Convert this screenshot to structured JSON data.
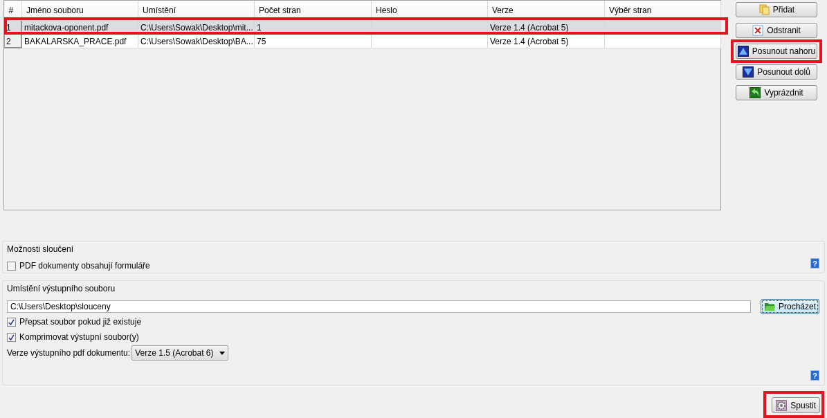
{
  "table": {
    "columns": [
      "#",
      "Jméno souboru",
      "Umístění",
      "Počet stran",
      "Heslo",
      "Verze",
      "Výběr stran"
    ],
    "rows": [
      {
        "selected": true,
        "highlighted": true,
        "cells": [
          "1",
          "mitackova-oponent.pdf",
          "C:\\Users\\Sowak\\Desktop\\mit...",
          "1",
          "",
          "Verze 1.4 (Acrobat 5)",
          ""
        ]
      },
      {
        "selected": false,
        "highlighted": false,
        "cells": [
          "2",
          "BAKALARSKA_PRACE.pdf",
          "C:\\Users\\Sowak\\Desktop\\BA...",
          "75",
          "",
          "Verze 1.4 (Acrobat 5)",
          ""
        ]
      }
    ]
  },
  "side_buttons": [
    {
      "kind": "add",
      "label": "Přidat",
      "highlighted": false
    },
    {
      "kind": "remove",
      "label": "Odstranit",
      "highlighted": false
    },
    {
      "kind": "up",
      "label": "Posunout nahoru",
      "highlighted": true
    },
    {
      "kind": "down",
      "label": "Posunout dolů",
      "highlighted": false
    },
    {
      "kind": "clear",
      "label": "Vyprázdnit",
      "highlighted": false
    }
  ],
  "merge_options": {
    "title": "Možnosti sloučení",
    "checkboxes": [
      {
        "label": "PDF dokumenty obsahují formuláře",
        "checked": false
      }
    ],
    "help": "?"
  },
  "output": {
    "title": "Umístění výstupního souboru",
    "path": "C:\\Users\\Desktop\\slouceny",
    "browse": "Procházet",
    "checkboxes": [
      {
        "label": "Přepsat soubor pokud již existuje",
        "checked": true
      },
      {
        "label": "Komprimovat výstupní soubor(y)",
        "checked": true
      }
    ],
    "version_label": "Verze výstupního pdf dokumentu:",
    "version_value": "Verze 1.5 (Acrobat 6)",
    "help": "?"
  },
  "run_button": {
    "label": "Spustit",
    "highlighted": true
  }
}
